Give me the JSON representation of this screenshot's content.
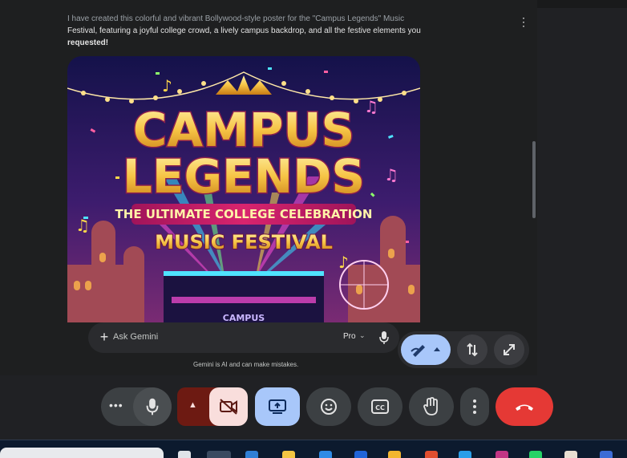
{
  "message": {
    "line1": "I have created this colorful and vibrant Bollywood-style poster for the \"Campus Legends\" Music",
    "line2": "Festival, featuring a joyful college crowd, a lively campus backdrop, and all the festive elements you",
    "line3": "requested!"
  },
  "poster": {
    "title_line1": "CAMPUS",
    "title_line2": "LEGENDS",
    "subtitle": "THE ULTIMATE COLLEGE CELEBRATION",
    "event": "MUSIC FESTIVAL",
    "stage_sign": "CAMPUS"
  },
  "prompt": {
    "placeholder": "Ask Gemini",
    "model": "Pro",
    "disclaimer": "Gemini is AI and can make mistakes."
  },
  "icons": {
    "add": "plus-icon",
    "mic": "microphone-icon",
    "more": "more-vert-icon",
    "pen": "pen-icon",
    "swap": "swap-vert-icon",
    "expand": "expand-icon",
    "cam_off": "videocam-off-icon",
    "present": "present-screen-icon",
    "emoji": "emoji-icon",
    "cc": "closed-captions-icon",
    "hand": "raise-hand-icon",
    "hangup": "call-end-icon"
  },
  "colors": {
    "accent_blue": "#a8c7fa",
    "hangup_red": "#e53935",
    "cam_off_bg": "#f9dedc"
  }
}
